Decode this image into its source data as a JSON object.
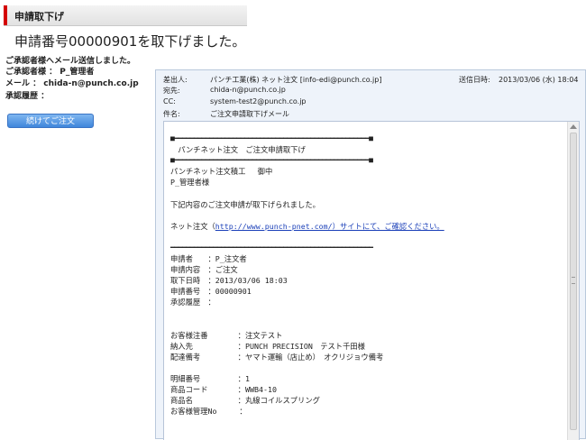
{
  "section_header": "申請取下げ",
  "headline": "申請番号00000901を取下げました。",
  "notice": "ご承認者様へメール送信しました。",
  "approver": {
    "label": "ご承認者様 ：",
    "value": "P_管理者"
  },
  "email": {
    "label": "メール ：",
    "value": "chida-n@punch.co.jp"
  },
  "history": {
    "label": "承認履歴 ：",
    "value": ""
  },
  "continue_button": "続けてご注文",
  "mail": {
    "from_label": "差出人:",
    "from": "パンチ工業(株) ネット注文 [info-edi@punch.co.jp]",
    "sent_label": "送信日時:",
    "sent": "2013/03/06 (水) 18:04",
    "to_label": "宛先:",
    "to": "chida-n@punch.co.jp",
    "cc_label": "CC:",
    "cc": "system-test2@punch.co.jp",
    "subject_label": "件名:",
    "subject": "ご注文申請取下げメール",
    "rule_top": "■━━━━━━━━━━━━━━━━━━━━━━━━━━━━━━━━━━━━━━━━━━━━━━━━━━■",
    "banner": "　パンチネット注文　ご注文申請取下げ",
    "rule_bottom": "■━━━━━━━━━━━━━━━━━━━━━━━━━━━━━━━━━━━━━━━━━━━━━━━━━━■",
    "company": "パンチネット注文積工　 御中",
    "recipient": "P_管理者様",
    "intro": "下記内容のご注文申請が取下げられました。",
    "net_prefix": "ネット注文（",
    "net_link": "http://www.punch-pnet.com/）サイトにて、ご確認ください。",
    "rule_mid": "━━━━━━━━━━━━━━━━━━━━━━━━━━━━━━━━━━━━━━━━━━━━━━━━━━━━",
    "fields": [
      "申請者　　：P_注文者",
      "申請内容　：ご注文",
      "取下日時　：2013/03/06 18:03",
      "申請番号　：00000901",
      "承認履歴　："
    ],
    "order_fields": [
      "お客様注番　　　　：注文テスト",
      "納入先　　　　　　：PUNCH PRECISION　テスト千田様",
      "配達備考　　　　　：ヤマト運輸（店止め）　オクリジョウ備考"
    ],
    "detail_fields": [
      "明細番号　　　　　：1",
      "商品コード　　　　：WWB4-10",
      "商品名　　　　　　：丸線コイルスプリング",
      "お客様管理No　　　："
    ]
  }
}
